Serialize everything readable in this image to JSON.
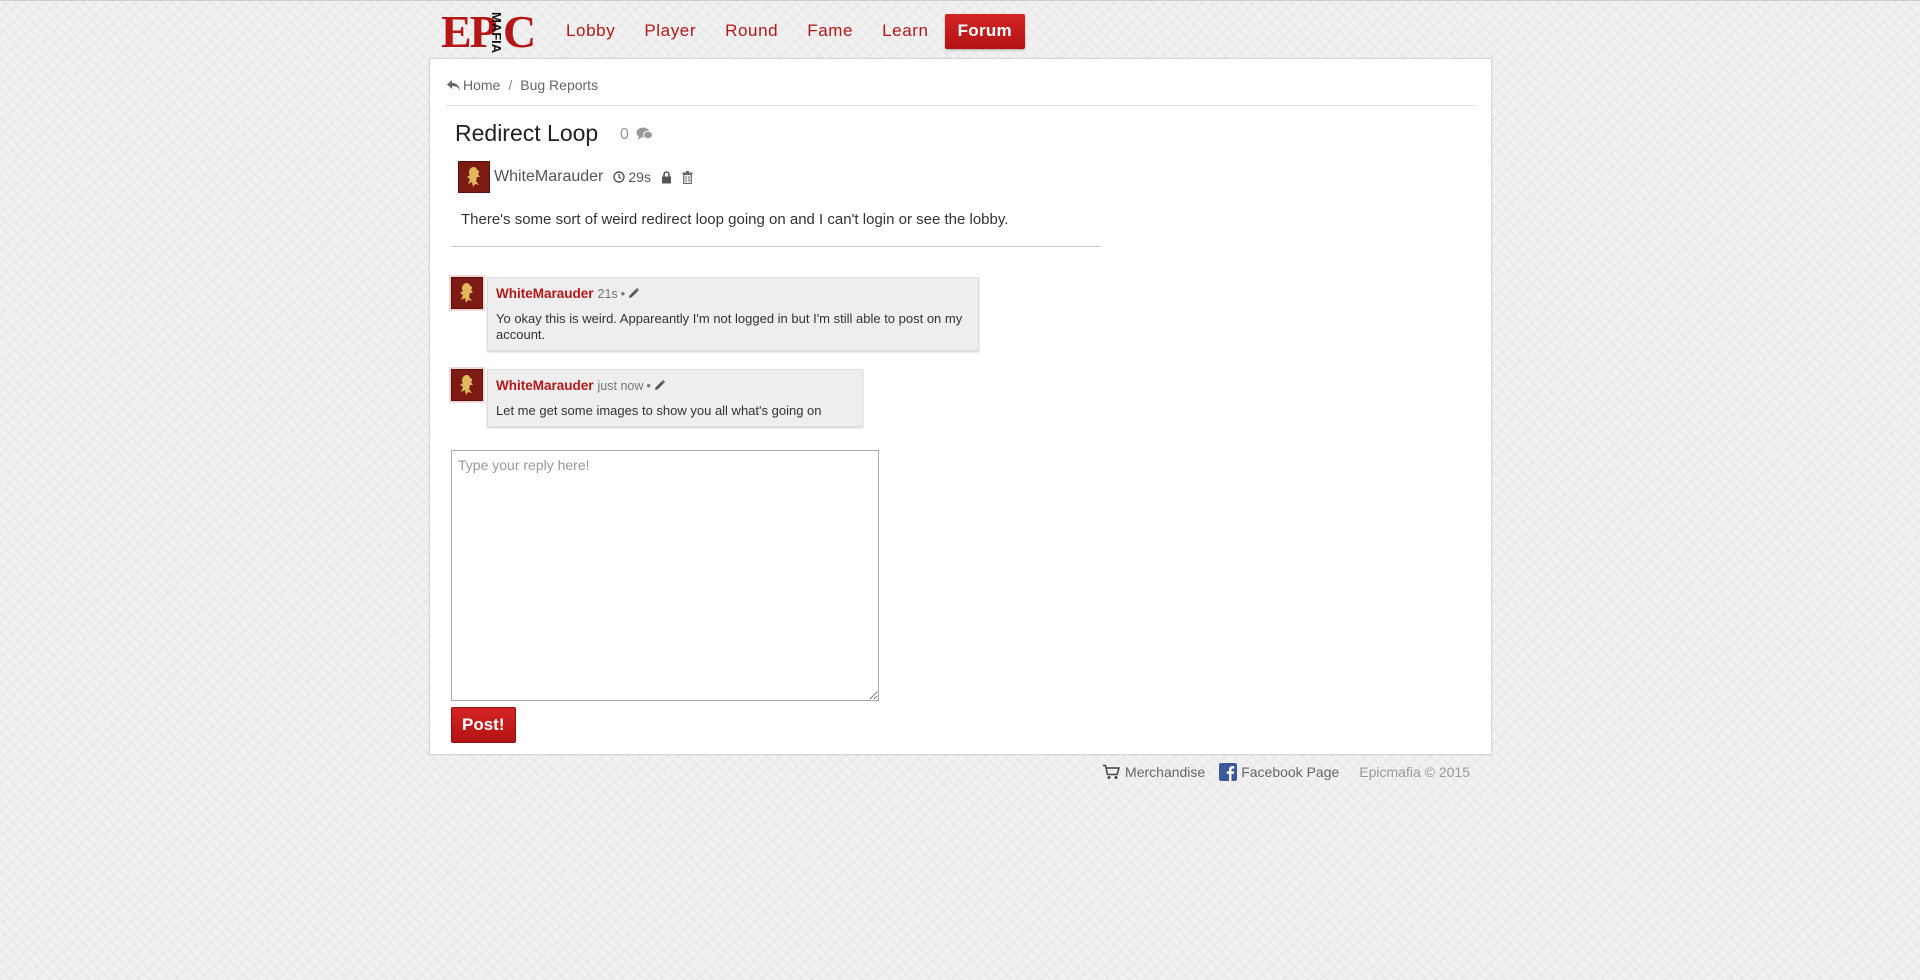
{
  "logo": {
    "part1": "EP",
    "part2": "MAFIA",
    "part3": "C"
  },
  "nav": {
    "items": [
      {
        "label": "Lobby"
      },
      {
        "label": "Player"
      },
      {
        "label": "Round"
      },
      {
        "label": "Fame"
      },
      {
        "label": "Learn"
      },
      {
        "label": "Forum",
        "active": true
      }
    ]
  },
  "breadcrumb": {
    "home": "Home",
    "separator": "/",
    "section": "Bug Reports"
  },
  "thread": {
    "title": "Redirect Loop",
    "comment_count": "0",
    "author": "WhiteMarauder",
    "time": "29s",
    "body": "There's some sort of weird redirect loop going on and I can't login or see the lobby."
  },
  "comments": [
    {
      "author": "WhiteMarauder",
      "time": "21s",
      "separator": "•",
      "text": "Yo okay this is weird. Appareantly I'm not logged in but I'm still able to post on my account."
    },
    {
      "author": "WhiteMarauder",
      "time": "just now",
      "separator": "•",
      "text": "Let me get some images to show you all what's going on"
    }
  ],
  "reply": {
    "placeholder": "Type your reply here!",
    "button": "Post!"
  },
  "footer": {
    "merch": "Merchandise",
    "facebook": "Facebook Page",
    "copyright": "Epicmafia © 2015"
  },
  "colors": {
    "brand_red": "#b51616",
    "bubble_bg": "#eeeeee"
  },
  "icons": [
    "home-back-icon",
    "comments-icon",
    "clock-icon",
    "lock-icon",
    "trash-icon",
    "pencil-icon",
    "cart-icon",
    "facebook-icon",
    "lion-avatar-icon"
  ]
}
